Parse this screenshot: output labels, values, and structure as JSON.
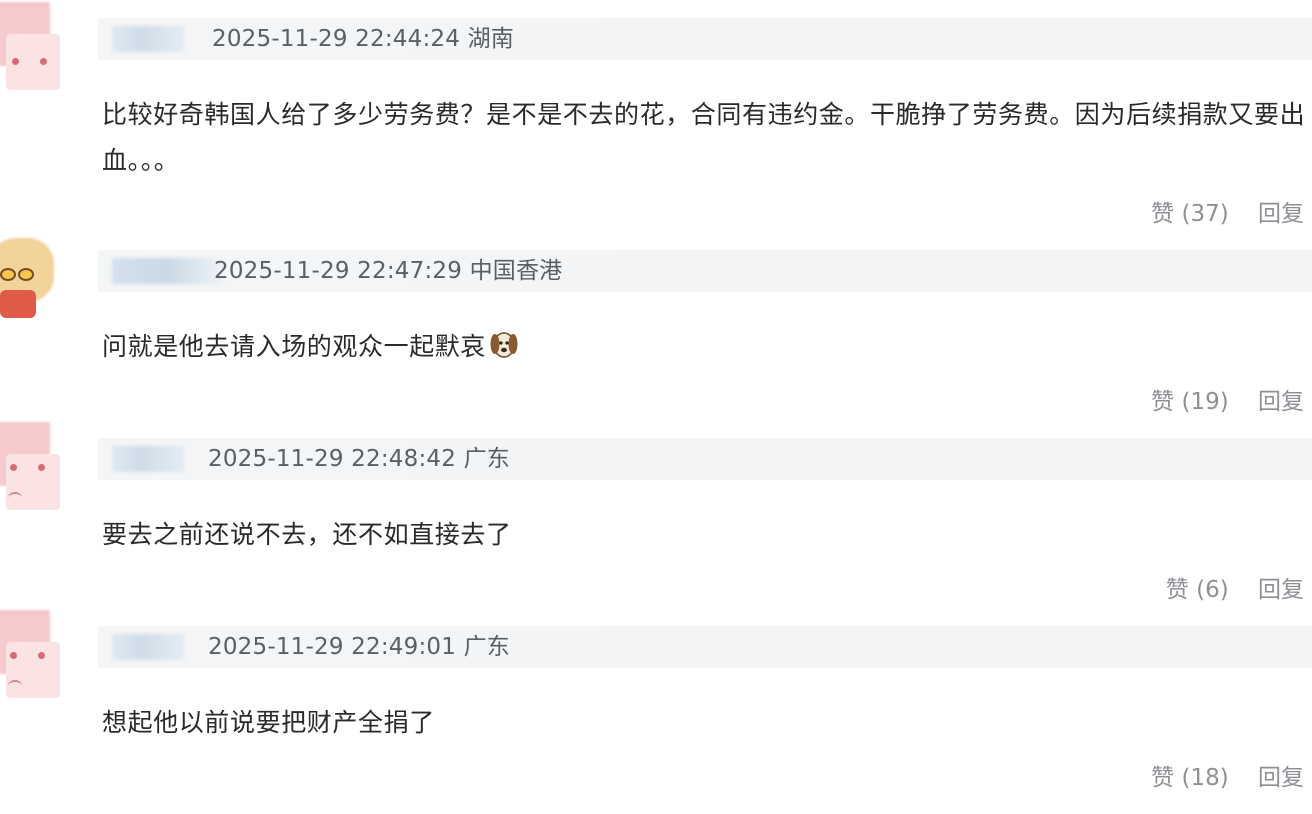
{
  "comments": [
    {
      "meta": "2025-11-29 22:44:24 湖南",
      "text": "比较好奇韩国人给了多少劳务费？是不是不去的花，合同有违约金。干脆挣了劳务费。因为后续捐款又要出血。。。",
      "like_label": "赞 (37)",
      "reply_label": "回复"
    },
    {
      "meta": "2025-11-29 22:47:29 中国香港",
      "text": "问就是他去请入场的观众一起默哀",
      "emoji": "dog-emoji",
      "like_label": "赞 (19)",
      "reply_label": "回复"
    },
    {
      "meta": "2025-11-29 22:48:42 广东",
      "text": "要去之前还说不去，还不如直接去了",
      "like_label": "赞 (6)",
      "reply_label": "回复"
    },
    {
      "meta": "2025-11-29 22:49:01 广东",
      "text": "想起他以前说要把财产全捐了",
      "like_label": "赞 (18)",
      "reply_label": "回复"
    }
  ]
}
